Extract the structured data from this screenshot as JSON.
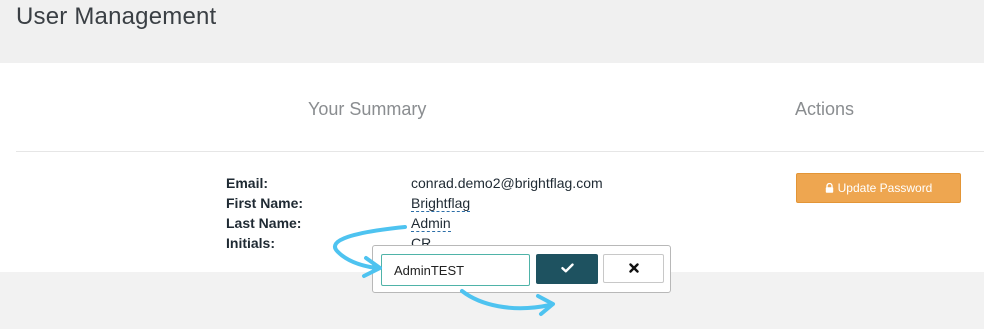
{
  "page": {
    "title": "User Management"
  },
  "summary": {
    "header": "Your Summary",
    "actions_header": "Actions",
    "fields": [
      {
        "label": "Email:",
        "value": "conrad.demo2@brightflag.com"
      },
      {
        "label": "First Name:",
        "value": "Brightflag"
      },
      {
        "label": "Last Name:",
        "value": "Admin"
      },
      {
        "label": "Initials:",
        "value": "CR"
      }
    ]
  },
  "actions": {
    "update_password_label": "Update Password"
  },
  "inline_edit": {
    "value": "AdminTEST"
  },
  "colors": {
    "accent_orange": "#eea650",
    "confirm_teal": "#1e5260",
    "input_border": "#4fb3a8",
    "annotation_arrow": "#4ec3f0"
  }
}
